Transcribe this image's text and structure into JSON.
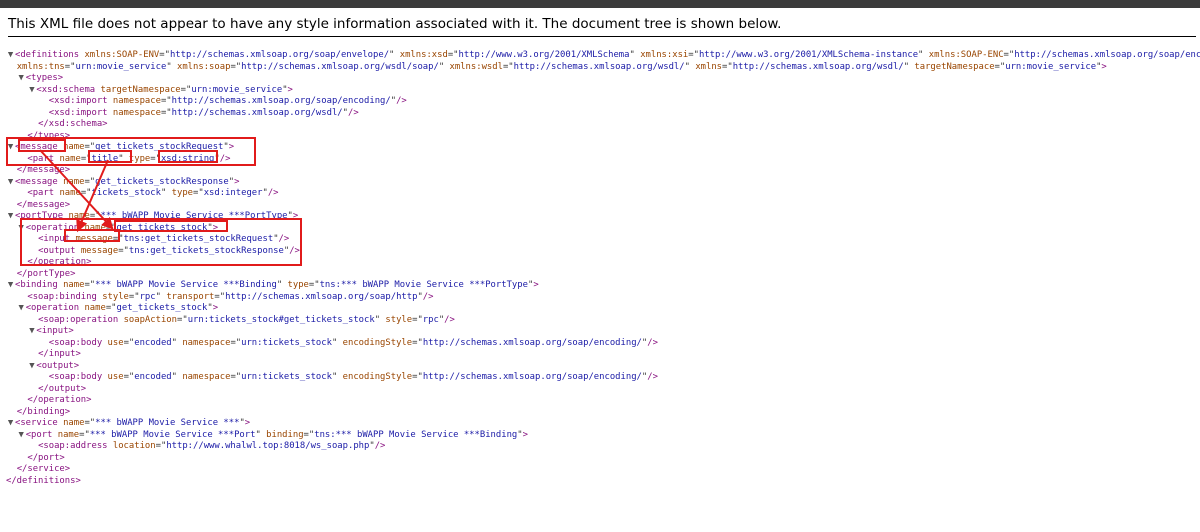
{
  "header": {
    "text": "This XML file does not appear to have any style information associated with it. The document tree is shown below."
  },
  "colors": {
    "annotation": "#e11b1b",
    "tag": "#881280",
    "attr": "#994500",
    "value": "#1a1aa6"
  },
  "lines": [
    [
      [
        "tog",
        "▼"
      ],
      [
        "t",
        "<definitions "
      ],
      [
        "a",
        "xmlns:SOAP-ENV"
      ],
      [
        "p",
        "=\""
      ],
      [
        "v",
        "http://schemas.xmlsoap.org/soap/envelope/"
      ],
      [
        "p",
        "\" "
      ],
      [
        "a",
        "xmlns:xsd"
      ],
      [
        "p",
        "=\""
      ],
      [
        "v",
        "http://www.w3.org/2001/XMLSchema"
      ],
      [
        "p",
        "\" "
      ],
      [
        "a",
        "xmlns:xsi"
      ],
      [
        "p",
        "=\""
      ],
      [
        "v",
        "http://www.w3.org/2001/XMLSchema-instance"
      ],
      [
        "p",
        "\" "
      ],
      [
        "a",
        "xmlns:SOAP-ENC"
      ],
      [
        "p",
        "=\""
      ],
      [
        "v",
        "http://schemas.xmlsoap.org/soap/encoding/"
      ],
      [
        "p",
        "\""
      ]
    ],
    [
      [
        "sp",
        "  "
      ],
      [
        "a",
        "xmlns:tns"
      ],
      [
        "p",
        "=\""
      ],
      [
        "v",
        "urn:movie_service"
      ],
      [
        "p",
        "\" "
      ],
      [
        "a",
        "xmlns:soap"
      ],
      [
        "p",
        "=\""
      ],
      [
        "v",
        "http://schemas.xmlsoap.org/wsdl/soap/"
      ],
      [
        "p",
        "\" "
      ],
      [
        "a",
        "xmlns:wsdl"
      ],
      [
        "p",
        "=\""
      ],
      [
        "v",
        "http://schemas.xmlsoap.org/wsdl/"
      ],
      [
        "p",
        "\" "
      ],
      [
        "a",
        "xmlns"
      ],
      [
        "p",
        "=\""
      ],
      [
        "v",
        "http://schemas.xmlsoap.org/wsdl/"
      ],
      [
        "p",
        "\" "
      ],
      [
        "a",
        "targetNamespace"
      ],
      [
        "p",
        "=\""
      ],
      [
        "v",
        "urn:movie_service"
      ],
      [
        "p",
        "\""
      ],
      [
        "t",
        ">"
      ]
    ],
    [
      [
        "sp",
        "  "
      ],
      [
        "tog",
        "▼"
      ],
      [
        "t",
        "<types>"
      ]
    ],
    [
      [
        "sp",
        "    "
      ],
      [
        "tog",
        "▼"
      ],
      [
        "t",
        "<xsd:schema "
      ],
      [
        "a",
        "targetNamespace"
      ],
      [
        "p",
        "=\""
      ],
      [
        "v",
        "urn:movie_service"
      ],
      [
        "p",
        "\""
      ],
      [
        "t",
        ">"
      ]
    ],
    [
      [
        "sp",
        "        "
      ],
      [
        "t",
        "<xsd:import "
      ],
      [
        "a",
        "namespace"
      ],
      [
        "p",
        "=\""
      ],
      [
        "v",
        "http://schemas.xmlsoap.org/soap/encoding/"
      ],
      [
        "p",
        "\""
      ],
      [
        "t",
        "/>"
      ]
    ],
    [
      [
        "sp",
        "        "
      ],
      [
        "t",
        "<xsd:import "
      ],
      [
        "a",
        "namespace"
      ],
      [
        "p",
        "=\""
      ],
      [
        "v",
        "http://schemas.xmlsoap.org/wsdl/"
      ],
      [
        "p",
        "\""
      ],
      [
        "t",
        "/>"
      ]
    ],
    [
      [
        "sp",
        "      "
      ],
      [
        "t",
        "</xsd:schema>"
      ]
    ],
    [
      [
        "sp",
        "    "
      ],
      [
        "t",
        "</types>"
      ]
    ],
    [
      [
        "tog",
        "▼"
      ],
      [
        "t",
        "<message "
      ],
      [
        "a",
        "name"
      ],
      [
        "p",
        "=\""
      ],
      [
        "v",
        "get_tickets_stockRequest"
      ],
      [
        "p",
        "\""
      ],
      [
        "t",
        ">"
      ]
    ],
    [
      [
        "sp",
        "    "
      ],
      [
        "t",
        "<part "
      ],
      [
        "a",
        "name"
      ],
      [
        "p",
        "=\""
      ],
      [
        "v",
        "title"
      ],
      [
        "p",
        "\" "
      ],
      [
        "a",
        "type"
      ],
      [
        "p",
        "=\""
      ],
      [
        "v",
        "xsd:string"
      ],
      [
        "p",
        "\""
      ],
      [
        "t",
        "/>"
      ]
    ],
    [
      [
        "sp",
        "  "
      ],
      [
        "t",
        "</message>"
      ]
    ],
    [
      [
        "tog",
        "▼"
      ],
      [
        "t",
        "<message "
      ],
      [
        "a",
        "name"
      ],
      [
        "p",
        "=\""
      ],
      [
        "v",
        "get_tickets_stockResponse"
      ],
      [
        "p",
        "\""
      ],
      [
        "t",
        ">"
      ]
    ],
    [
      [
        "sp",
        "    "
      ],
      [
        "t",
        "<part "
      ],
      [
        "a",
        "name"
      ],
      [
        "p",
        "=\""
      ],
      [
        "v",
        "tickets_stock"
      ],
      [
        "p",
        "\" "
      ],
      [
        "a",
        "type"
      ],
      [
        "p",
        "=\""
      ],
      [
        "v",
        "xsd:integer"
      ],
      [
        "p",
        "\""
      ],
      [
        "t",
        "/>"
      ]
    ],
    [
      [
        "sp",
        "  "
      ],
      [
        "t",
        "</message>"
      ]
    ],
    [
      [
        "tog",
        "▼"
      ],
      [
        "t",
        "<portType "
      ],
      [
        "a",
        "name"
      ],
      [
        "p",
        "=\""
      ],
      [
        "v",
        "*** bWAPP Movie Service ***PortType"
      ],
      [
        "p",
        "\""
      ],
      [
        "t",
        ">"
      ]
    ],
    [
      [
        "sp",
        "  "
      ],
      [
        "tog",
        "▼"
      ],
      [
        "t",
        "<operation "
      ],
      [
        "a",
        "name"
      ],
      [
        "p",
        "=\""
      ],
      [
        "v",
        "get_tickets_stock"
      ],
      [
        "p",
        "\""
      ],
      [
        "t",
        ">"
      ]
    ],
    [
      [
        "sp",
        "      "
      ],
      [
        "t",
        "<input "
      ],
      [
        "a",
        "message"
      ],
      [
        "p",
        "=\""
      ],
      [
        "v",
        "tns:get_tickets_stockRequest"
      ],
      [
        "p",
        "\""
      ],
      [
        "t",
        "/>"
      ]
    ],
    [
      [
        "sp",
        "      "
      ],
      [
        "t",
        "<output "
      ],
      [
        "a",
        "message"
      ],
      [
        "p",
        "=\""
      ],
      [
        "v",
        "tns:get_tickets_stockResponse"
      ],
      [
        "p",
        "\""
      ],
      [
        "t",
        "/>"
      ]
    ],
    [
      [
        "sp",
        "    "
      ],
      [
        "t",
        "</operation>"
      ]
    ],
    [
      [
        "sp",
        "  "
      ],
      [
        "t",
        "</portType>"
      ]
    ],
    [
      [
        "tog",
        "▼"
      ],
      [
        "t",
        "<binding "
      ],
      [
        "a",
        "name"
      ],
      [
        "p",
        "=\""
      ],
      [
        "v",
        "*** bWAPP Movie Service ***Binding"
      ],
      [
        "p",
        "\" "
      ],
      [
        "a",
        "type"
      ],
      [
        "p",
        "=\""
      ],
      [
        "v",
        "tns:*** bWAPP Movie Service ***PortType"
      ],
      [
        "p",
        "\""
      ],
      [
        "t",
        ">"
      ]
    ],
    [
      [
        "sp",
        "    "
      ],
      [
        "t",
        "<soap:binding "
      ],
      [
        "a",
        "style"
      ],
      [
        "p",
        "=\""
      ],
      [
        "v",
        "rpc"
      ],
      [
        "p",
        "\" "
      ],
      [
        "a",
        "transport"
      ],
      [
        "p",
        "=\""
      ],
      [
        "v",
        "http://schemas.xmlsoap.org/soap/http"
      ],
      [
        "p",
        "\""
      ],
      [
        "t",
        "/>"
      ]
    ],
    [
      [
        "sp",
        "  "
      ],
      [
        "tog",
        "▼"
      ],
      [
        "t",
        "<operation "
      ],
      [
        "a",
        "name"
      ],
      [
        "p",
        "=\""
      ],
      [
        "v",
        "get_tickets_stock"
      ],
      [
        "p",
        "\""
      ],
      [
        "t",
        ">"
      ]
    ],
    [
      [
        "sp",
        "      "
      ],
      [
        "t",
        "<soap:operation "
      ],
      [
        "a",
        "soapAction"
      ],
      [
        "p",
        "=\""
      ],
      [
        "v",
        "urn:tickets_stock#get_tickets_stock"
      ],
      [
        "p",
        "\" "
      ],
      [
        "a",
        "style"
      ],
      [
        "p",
        "=\""
      ],
      [
        "v",
        "rpc"
      ],
      [
        "p",
        "\""
      ],
      [
        "t",
        "/>"
      ]
    ],
    [
      [
        "sp",
        "    "
      ],
      [
        "tog",
        "▼"
      ],
      [
        "t",
        "<input>"
      ]
    ],
    [
      [
        "sp",
        "        "
      ],
      [
        "t",
        "<soap:body "
      ],
      [
        "a",
        "use"
      ],
      [
        "p",
        "=\""
      ],
      [
        "v",
        "encoded"
      ],
      [
        "p",
        "\" "
      ],
      [
        "a",
        "namespace"
      ],
      [
        "p",
        "=\""
      ],
      [
        "v",
        "urn:tickets_stock"
      ],
      [
        "p",
        "\" "
      ],
      [
        "a",
        "encodingStyle"
      ],
      [
        "p",
        "=\""
      ],
      [
        "v",
        "http://schemas.xmlsoap.org/soap/encoding/"
      ],
      [
        "p",
        "\""
      ],
      [
        "t",
        "/>"
      ]
    ],
    [
      [
        "sp",
        "      "
      ],
      [
        "t",
        "</input>"
      ]
    ],
    [
      [
        "sp",
        "    "
      ],
      [
        "tog",
        "▼"
      ],
      [
        "t",
        "<output>"
      ]
    ],
    [
      [
        "sp",
        "        "
      ],
      [
        "t",
        "<soap:body "
      ],
      [
        "a",
        "use"
      ],
      [
        "p",
        "=\""
      ],
      [
        "v",
        "encoded"
      ],
      [
        "p",
        "\" "
      ],
      [
        "a",
        "namespace"
      ],
      [
        "p",
        "=\""
      ],
      [
        "v",
        "urn:tickets_stock"
      ],
      [
        "p",
        "\" "
      ],
      [
        "a",
        "encodingStyle"
      ],
      [
        "p",
        "=\""
      ],
      [
        "v",
        "http://schemas.xmlsoap.org/soap/encoding/"
      ],
      [
        "p",
        "\""
      ],
      [
        "t",
        "/>"
      ]
    ],
    [
      [
        "sp",
        "      "
      ],
      [
        "t",
        "</output>"
      ]
    ],
    [
      [
        "sp",
        "    "
      ],
      [
        "t",
        "</operation>"
      ]
    ],
    [
      [
        "sp",
        "  "
      ],
      [
        "t",
        "</binding>"
      ]
    ],
    [
      [
        "tog",
        "▼"
      ],
      [
        "t",
        "<service "
      ],
      [
        "a",
        "name"
      ],
      [
        "p",
        "=\""
      ],
      [
        "v",
        "*** bWAPP Movie Service ***"
      ],
      [
        "p",
        "\""
      ],
      [
        "t",
        ">"
      ]
    ],
    [
      [
        "sp",
        "  "
      ],
      [
        "tog",
        "▼"
      ],
      [
        "t",
        "<port "
      ],
      [
        "a",
        "name"
      ],
      [
        "p",
        "=\""
      ],
      [
        "v",
        "*** bWAPP Movie Service ***Port"
      ],
      [
        "p",
        "\" "
      ],
      [
        "a",
        "binding"
      ],
      [
        "p",
        "=\""
      ],
      [
        "v",
        "tns:*** bWAPP Movie Service ***Binding"
      ],
      [
        "p",
        "\""
      ],
      [
        "t",
        ">"
      ]
    ],
    [
      [
        "sp",
        "      "
      ],
      [
        "t",
        "<soap:address "
      ],
      [
        "a",
        "location"
      ],
      [
        "p",
        "=\""
      ],
      [
        "v",
        "http://www.whalwl.top:8018/ws_soap.php"
      ],
      [
        "p",
        "\""
      ],
      [
        "t",
        "/>"
      ]
    ],
    [
      [
        "sp",
        "    "
      ],
      [
        "t",
        "</port>"
      ]
    ],
    [
      [
        "sp",
        "  "
      ],
      [
        "t",
        "</service>"
      ]
    ],
    [
      [
        "t",
        "</definitions>"
      ]
    ]
  ]
}
